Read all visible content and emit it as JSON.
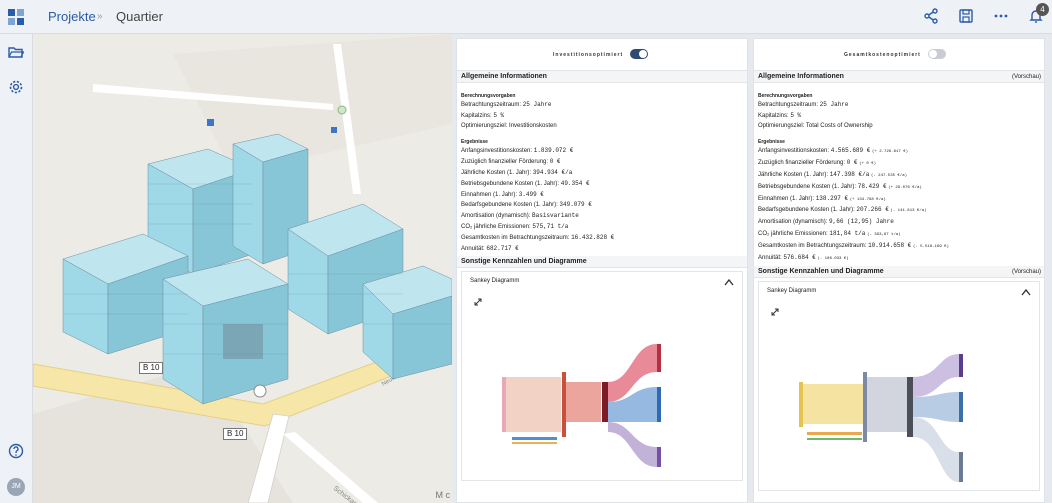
{
  "header": {
    "crumb_projects": "Projekte",
    "crumb_separator": "»",
    "crumb_current": "Quartier",
    "notification_count": "4",
    "icons": [
      "share-icon",
      "save-icon",
      "more-icon",
      "bell-icon"
    ]
  },
  "sidebar": {
    "icons": [
      "folder-open-icon",
      "settings-icon",
      "help-icon"
    ],
    "avatar_initials": "JM"
  },
  "map": {
    "road_labels": [
      "B 10",
      "B 10"
    ],
    "attribution": "M c"
  },
  "panels": [
    {
      "toggle_label": "Investitionsoptimiert",
      "toggle_on": true,
      "general_title": "Allgemeine Informationen",
      "vorschau": "",
      "specs_title": "Berechnungsvorgaben",
      "specs": [
        {
          "label": "Betrachtungszeitraum:",
          "value": "25 Jahre"
        },
        {
          "label": "Kapitalzins:",
          "value": "5 %"
        },
        {
          "label": "Optimierungsziel:",
          "value": "Investitionskosten"
        }
      ],
      "results_title": "Ergebnisse",
      "results": [
        {
          "label": "Anfangsinvestitionskosten:",
          "value": "1.839.072 €",
          "diff": ""
        },
        {
          "label": "Zuzüglich finanzieller Förderung:",
          "value": "0 €",
          "diff": ""
        },
        {
          "label": "Jährliche Kosten (1. Jahr):",
          "value": "394.934 €/a",
          "diff": ""
        },
        {
          "label": "Betriebsgebundene Kosten (1. Jahr):",
          "value": "49.354 €",
          "diff": ""
        },
        {
          "label": "Einnahmen (1. Jahr):",
          "value": "3.499 €",
          "diff": ""
        },
        {
          "label": "Bedarfsgebundene Kosten (1. Jahr):",
          "value": "349.079 €",
          "diff": ""
        },
        {
          "label": "Amortisation (dynamisch):",
          "value": "Basisvariante",
          "diff": ""
        },
        {
          "label": "CO₂ jährliche Emissionen:",
          "value": "575,71 t/a",
          "diff": ""
        },
        {
          "label": "Gesamtkosten im Betrachtungszeitraum:",
          "value": "16.432.828 €",
          "diff": ""
        },
        {
          "label": "Annuität:",
          "value": "682.717 €",
          "diff": ""
        }
      ],
      "other_title": "Sonstige Kennzahlen und Diagramme",
      "other_vorschau": "",
      "sankey_title": "Sankey Diagramm"
    },
    {
      "toggle_label": "Gesamtkostenoptimiert",
      "toggle_on": false,
      "general_title": "Allgemeine Informationen",
      "vorschau": "(Vorschau)",
      "specs_title": "Berechnungsvorgaben",
      "specs": [
        {
          "label": "Betrachtungszeitraum:",
          "value": "25 Jahre"
        },
        {
          "label": "Kapitalzins:",
          "value": "5 %"
        },
        {
          "label": "Optimierungsziel:",
          "value": "Total Costs of Ownership"
        }
      ],
      "results_title": "Ergebnisse",
      "results": [
        {
          "label": "Anfangsinvestitionskosten:",
          "value": "4.565.689 €",
          "diff": "(+ 2.726.617 €)"
        },
        {
          "label": "Zuzüglich finanzieller Förderung:",
          "value": "0 €",
          "diff": "(+ 0 €)"
        },
        {
          "label": "Jährliche Kosten (1. Jahr):",
          "value": "147.398 €/a",
          "diff": "(- 247.535 €/a)"
        },
        {
          "label": "Betriebsgebundene Kosten (1. Jahr):",
          "value": "78.429 €",
          "diff": "(+ 29.076 €/a)"
        },
        {
          "label": "Einnahmen (1. Jahr):",
          "value": "138.297 €",
          "diff": "(+ 134.798 €/a)"
        },
        {
          "label": "Bedarfsgebundene Kosten (1. Jahr):",
          "value": "207.266 €",
          "diff": "(- 141.813 €/a)"
        },
        {
          "label": "Amortisation (dynamisch):",
          "value": "9,66 (12,95) Jahre",
          "diff": ""
        },
        {
          "label": "CO₂ jährliche Emissionen:",
          "value": "181,84 t/a",
          "diff": "(- 393,87 t/a)"
        },
        {
          "label": "Gesamtkosten im Betrachtungszeitraum:",
          "value": "10.914.658 €",
          "diff": "(- 5.518.169 €)"
        },
        {
          "label": "Annuität:",
          "value": "576.684 €",
          "diff": "(- 106.033 €)"
        }
      ],
      "other_title": "Sonstige Kennzahlen und Diagramme",
      "other_vorschau": "(Vorschau)",
      "sankey_title": "Sankey Diagramm"
    }
  ],
  "colors": {
    "accent": "#2a5ca8",
    "toggle_on": "#2f4b73",
    "toggle_off": "#c9cdd3",
    "building_fill": "#9fd8e6",
    "building_dark": "#6f8fa3",
    "road_yellow": "#f6e7a8"
  }
}
